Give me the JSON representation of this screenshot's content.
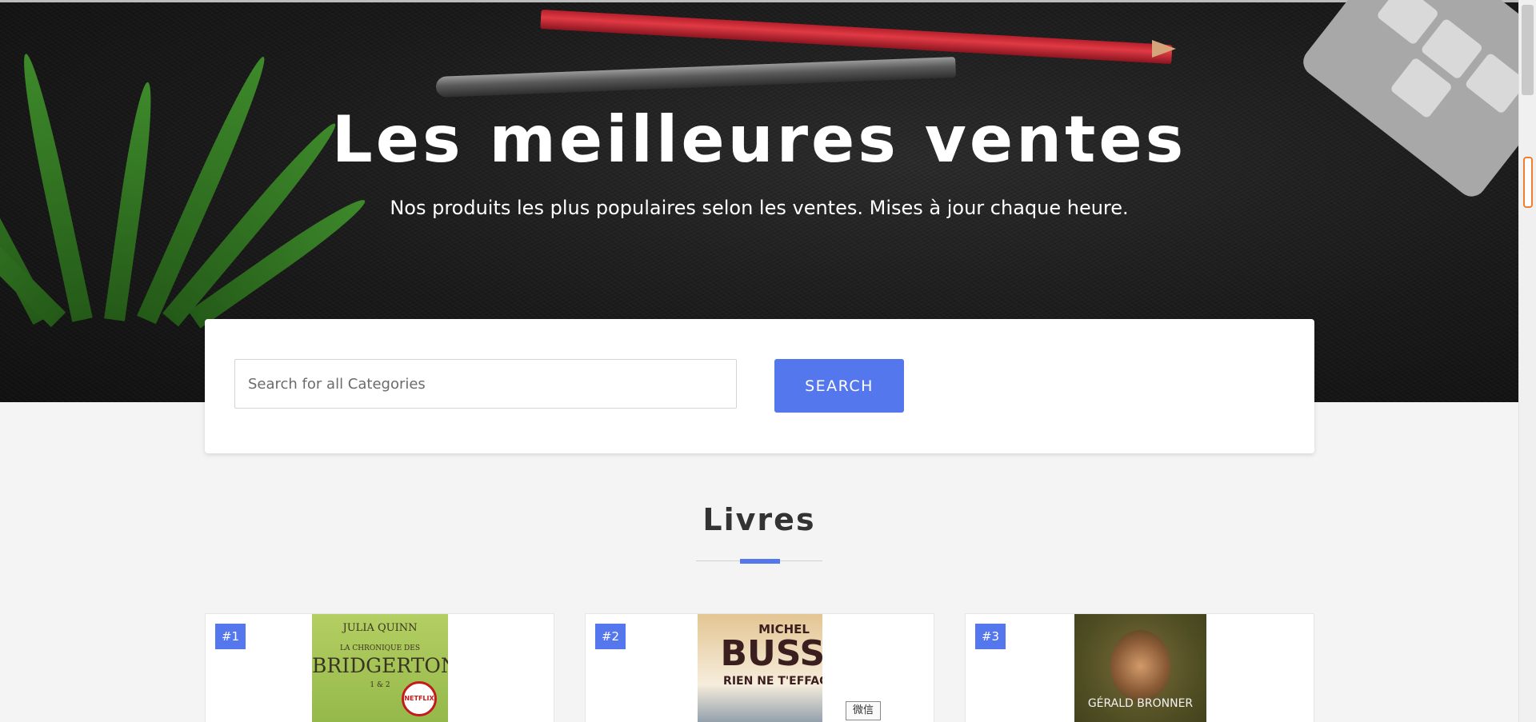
{
  "hero": {
    "title": "Les meilleures ventes",
    "subtitle": "Nos produits les plus populaires selon les ventes. Mises à jour chaque heure."
  },
  "search": {
    "placeholder": "Search for all Categories",
    "button_label": "SEARCH"
  },
  "section": {
    "title": "Livres"
  },
  "books": [
    {
      "rank": "#1",
      "cover_author": "JULIA QUINN",
      "cover_series": "LA CHRONIQUE DES",
      "cover_title": "BRIDGERTON",
      "cover_volume": "1 & 2",
      "badge": "NETFLIX"
    },
    {
      "rank": "#2",
      "cover_author": "MICHEL",
      "cover_title": "BUSSI",
      "cover_subtitle": "RIEN NE T'EFFACE"
    },
    {
      "rank": "#3",
      "cover_author": "GÉRALD BRONNER"
    }
  ],
  "tooltip": {
    "text": "微信"
  },
  "colors": {
    "accent": "#5577ee",
    "page_background": "#f4f4f4",
    "hero_background": "#1a1a1a"
  }
}
